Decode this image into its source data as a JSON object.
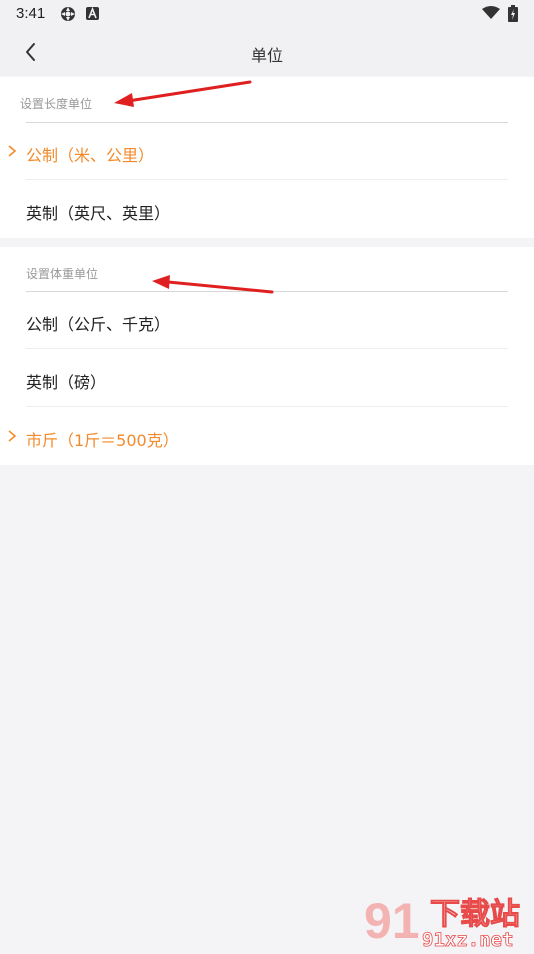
{
  "status_bar": {
    "time": "3:41"
  },
  "app_bar": {
    "title": "单位"
  },
  "sections": [
    {
      "header": "设置长度单位",
      "options": [
        {
          "label": "公制（米、公里）",
          "selected": true
        },
        {
          "label": "英制（英尺、英里）",
          "selected": false
        }
      ]
    },
    {
      "header": "设置体重单位",
      "options": [
        {
          "label": "公制（公斤、千克）",
          "selected": false
        },
        {
          "label": "英制（磅）",
          "selected": false
        },
        {
          "label": "市斤（1斤＝500克）",
          "selected": true
        }
      ]
    }
  ],
  "watermark": {
    "logo_text": "91",
    "site_name": "下载站",
    "url": "91xz.net"
  },
  "colors": {
    "accent": "#f48a2a",
    "annotation_arrow": "#e02020",
    "background": "#f4f4f6"
  }
}
